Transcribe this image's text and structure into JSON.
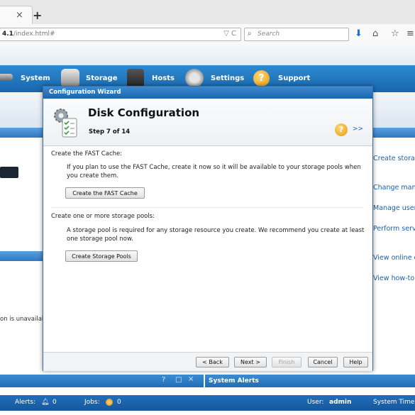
{
  "browser": {
    "tab_close": "×",
    "new_tab": "+",
    "url_host": "4.1",
    "url_path": "/index.html#",
    "url_controls": "▽ C",
    "search_placeholder": "Search"
  },
  "nav": {
    "items": [
      {
        "label": "System",
        "icon": "server-icon"
      },
      {
        "label": "Storage",
        "icon": "disk-stack-icon"
      },
      {
        "label": "Hosts",
        "icon": "host-building-icon"
      },
      {
        "label": "Settings",
        "icon": "gear-icon"
      },
      {
        "label": "Support",
        "icon": "help-icon"
      }
    ]
  },
  "right_links": [
    "Create stora",
    "Change man",
    "Manage user",
    "Perform serv",
    "View online c",
    "View how-to"
  ],
  "background": {
    "unavailable_text": "on is unavailab",
    "panel_icons": [
      "?",
      "□",
      "×"
    ],
    "system_alerts": "System Alerts"
  },
  "status": {
    "alerts_label": "Alerts:",
    "alerts_count": "0",
    "jobs_label": "Jobs:",
    "jobs_count": "0",
    "user_label": "User:",
    "user_name": "admin",
    "system_time_label": "System Time:"
  },
  "wizard": {
    "window_title": "Configuration Wizard",
    "heading": "Disk Configuration",
    "step": "Step 7 of 14",
    "help_more": ">>",
    "fast_cache_heading": "Create the FAST Cache:",
    "fast_cache_desc": "If you plan to use the FAST Cache, create it now so it will be available to your storage pools when you create them.",
    "fast_cache_button": "Create the FAST Cache",
    "pools_heading": "Create one or more storage pools:",
    "pools_desc": "A storage pool is required for any storage resource you create. We recommend you create at least one storage pool now.",
    "pools_button": "Create Storage Pools",
    "footer": {
      "back": "< Back",
      "next": "Next >",
      "finish": "Finish",
      "cancel": "Cancel",
      "help": "Help"
    }
  },
  "colors": {
    "nav_blue": "#1f72bb",
    "link_blue": "#1a5fae",
    "help_orange": "#e59a12"
  }
}
